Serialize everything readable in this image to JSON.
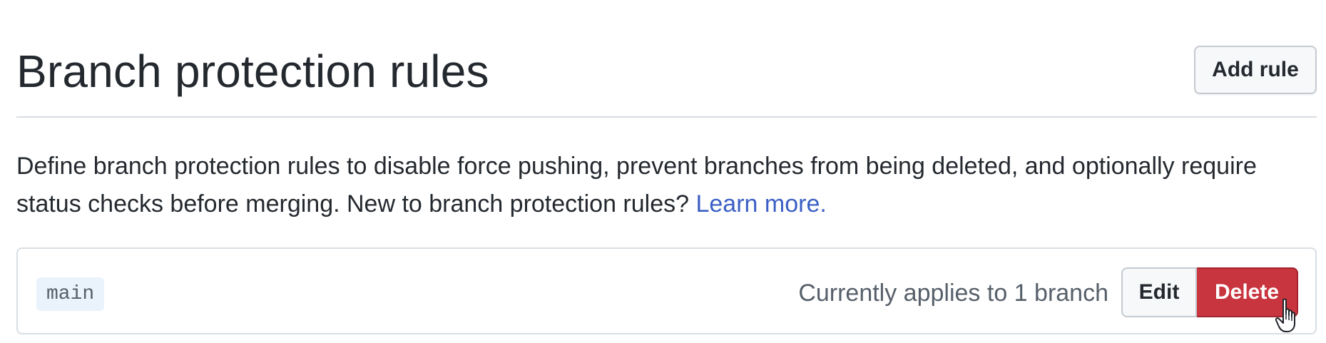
{
  "header": {
    "title": "Branch protection rules",
    "add_rule_label": "Add rule"
  },
  "description": {
    "text": "Define branch protection rules to disable force pushing, prevent branches from being deleted, and optionally require status checks before merging. New to branch protection rules? ",
    "link_text": "Learn more."
  },
  "rules": [
    {
      "branch": "main",
      "applies_text": "Currently applies to 1 branch",
      "edit_label": "Edit",
      "delete_label": "Delete"
    }
  ],
  "colors": {
    "link": "#3b5fc4",
    "danger": "#c8353f",
    "border": "#d8dee4"
  },
  "icons": {
    "cursor": "hand-pointer-cursor-icon"
  }
}
